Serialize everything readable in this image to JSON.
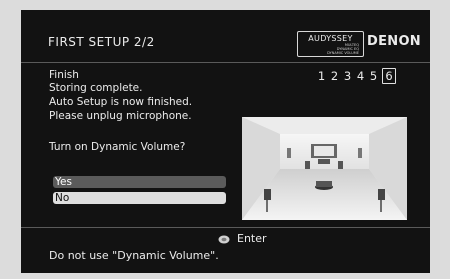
{
  "header": {
    "title": "FIRST  SETUP 2/2",
    "logo_text": "AUDYSSEY",
    "logo_subtext": [
      "MULTEQ",
      "DYNAMIC EQ",
      "DYNAMIC VOLUME"
    ],
    "brand": "DENON"
  },
  "content": {
    "section_title": "Finish",
    "messages": [
      "Storing complete.",
      "Auto Setup is now finished.",
      "Please unplug microphone."
    ],
    "question": "Turn on Dynamic Volume?",
    "steps": [
      "1",
      "2",
      "3",
      "4",
      "5",
      "6"
    ],
    "active_step": "6",
    "options": [
      {
        "label": "Yes",
        "selected": true
      },
      {
        "label": "No",
        "selected": false
      }
    ]
  },
  "footer": {
    "button_icon": "enter-button-icon",
    "button_label": "Enter",
    "guide": "Do not use \"Dynamic Volume\"."
  },
  "colors": {
    "screen_bg": "#121212",
    "bezel": "#dcdcdc",
    "text": "#ececec",
    "selected_option_bg": "#5b5b5b",
    "option_bg": "#dedede"
  }
}
